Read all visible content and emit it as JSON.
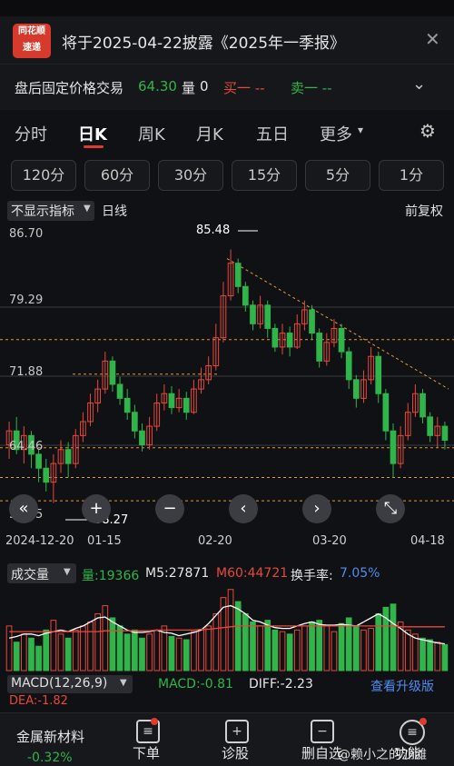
{
  "notice": {
    "logo_top": "同花顺",
    "logo_bottom": "速递",
    "text": "将于2025-04-22披露《2025年一季报》"
  },
  "after_hours": {
    "label": "盘后固定价格交易",
    "price": "64.30",
    "volume_label": "量",
    "volume": "0",
    "sell1": "买一 --",
    "buy1": "卖一 --"
  },
  "tabs": [
    "分时",
    "日K",
    "周K",
    "月K",
    "五日",
    "更多"
  ],
  "minute_buttons": [
    "120分",
    "60分",
    "30分",
    "15分",
    "5分",
    "1分"
  ],
  "indicator_bar": {
    "selector": "不显示指标",
    "period": "日线",
    "adjust": "前复权"
  },
  "chart_data": {
    "type": "candlestick",
    "y_ticks": [
      "86.70",
      "79.29",
      "71.88",
      "64.46",
      "57.05"
    ],
    "ylim": [
      57.05,
      86.7
    ],
    "x_ticks": [
      "2024-12-20",
      "01-15",
      "02-20",
      "03-20",
      "04-18"
    ],
    "high_label": "85.48",
    "low_label": "58.27",
    "colors": {
      "up": "#e8483a",
      "down": "#2fb54a",
      "ma": "#e39a3b"
    },
    "candles": [
      [
        64.5,
        66.0,
        63.0,
        67.0
      ],
      [
        66.0,
        64.0,
        63.5,
        67.5
      ],
      [
        64.0,
        65.5,
        62.5,
        66.5
      ],
      [
        65.5,
        63.5,
        62.0,
        66.0
      ],
      [
        63.5,
        62.0,
        60.5,
        64.0
      ],
      [
        62.0,
        60.5,
        59.5,
        63.0
      ],
      [
        60.5,
        62.5,
        58.27,
        63.5
      ],
      [
        62.5,
        64.0,
        61.5,
        65.0
      ],
      [
        64.0,
        62.5,
        61.0,
        64.8
      ],
      [
        62.5,
        65.5,
        62.0,
        66.2
      ],
      [
        65.5,
        67.0,
        64.8,
        68.0
      ],
      [
        67.0,
        69.0,
        66.5,
        70.0
      ],
      [
        69.0,
        70.5,
        68.0,
        71.5
      ],
      [
        70.5,
        73.5,
        70.0,
        74.5
      ],
      [
        73.5,
        71.0,
        70.2,
        74.0
      ],
      [
        71.0,
        69.5,
        68.8,
        71.8
      ],
      [
        69.5,
        68.0,
        67.2,
        70.5
      ],
      [
        68.0,
        66.0,
        65.2,
        68.8
      ],
      [
        66.0,
        64.5,
        63.8,
        66.8
      ],
      [
        64.5,
        66.5,
        64.0,
        67.5
      ],
      [
        66.5,
        69.0,
        66.0,
        70.0
      ],
      [
        69.0,
        70.0,
        68.2,
        71.0
      ],
      [
        70.0,
        68.5,
        67.8,
        70.8
      ],
      [
        68.5,
        69.5,
        68.0,
        70.5
      ],
      [
        69.5,
        68.0,
        67.2,
        70.2
      ],
      [
        68.0,
        70.5,
        67.8,
        71.5
      ],
      [
        70.5,
        71.5,
        70.0,
        72.8
      ],
      [
        71.5,
        73.0,
        71.0,
        74.0
      ],
      [
        73.0,
        76.0,
        72.5,
        77.5
      ],
      [
        76.0,
        80.5,
        75.5,
        82.0
      ],
      [
        80.5,
        84.0,
        80.0,
        85.48
      ],
      [
        84.0,
        81.5,
        80.8,
        84.5
      ],
      [
        81.5,
        79.5,
        78.8,
        82.0
      ],
      [
        79.5,
        77.5,
        76.8,
        80.0
      ],
      [
        77.5,
        79.5,
        77.0,
        80.5
      ],
      [
        79.5,
        77.0,
        76.0,
        80.0
      ],
      [
        77.0,
        75.0,
        74.5,
        77.5
      ],
      [
        75.0,
        76.5,
        74.2,
        77.5
      ],
      [
        76.5,
        75.0,
        74.0,
        77.2
      ],
      [
        75.0,
        77.5,
        74.8,
        78.5
      ],
      [
        77.5,
        79.0,
        76.8,
        80.0
      ],
      [
        79.0,
        76.5,
        75.8,
        79.5
      ],
      [
        76.5,
        73.5,
        72.8,
        77.0
      ],
      [
        73.5,
        75.5,
        73.0,
        76.5
      ],
      [
        75.5,
        77.0,
        75.0,
        78.0
      ],
      [
        77.0,
        74.5,
        73.8,
        77.5
      ],
      [
        74.5,
        71.5,
        70.5,
        75.0
      ],
      [
        71.5,
        69.5,
        68.5,
        72.0
      ],
      [
        69.5,
        71.5,
        69.0,
        72.5
      ],
      [
        71.5,
        74.0,
        71.0,
        75.0
      ],
      [
        74.0,
        70.0,
        69.0,
        74.5
      ],
      [
        70.0,
        66.0,
        65.0,
        70.5
      ],
      [
        66.0,
        62.5,
        61.0,
        66.8
      ],
      [
        62.5,
        65.5,
        62.0,
        66.5
      ],
      [
        65.5,
        68.0,
        65.0,
        69.0
      ],
      [
        68.0,
        70.0,
        67.5,
        71.0
      ],
      [
        70.0,
        67.5,
        66.8,
        70.5
      ],
      [
        67.5,
        65.5,
        64.8,
        68.0
      ],
      [
        65.5,
        66.5,
        64.2,
        67.5
      ],
      [
        66.5,
        65.0,
        64.0,
        67.0
      ]
    ]
  },
  "chart_controls": [
    "«",
    "+",
    "−",
    "‹",
    "›",
    "⤡"
  ],
  "volume": {
    "selector": "成交量",
    "vol_label": "量:19366",
    "m5_label": "M5:27871",
    "m60_label": "M60:44721",
    "turnover_label": "换手率:",
    "turnover_value": "7.05%",
    "bars": [
      0.55,
      0.35,
      0.45,
      0.4,
      0.3,
      0.5,
      0.62,
      0.45,
      0.4,
      0.5,
      0.55,
      0.6,
      0.7,
      0.8,
      0.65,
      0.55,
      0.45,
      0.5,
      0.4,
      0.45,
      0.5,
      0.55,
      0.42,
      0.4,
      0.38,
      0.48,
      0.5,
      0.55,
      0.7,
      0.9,
      1.0,
      0.85,
      0.7,
      0.6,
      0.55,
      0.62,
      0.5,
      0.48,
      0.45,
      0.5,
      0.55,
      0.6,
      0.62,
      0.55,
      0.48,
      0.58,
      0.65,
      0.55,
      0.5,
      0.52,
      0.7,
      0.78,
      0.82,
      0.6,
      0.5,
      0.45,
      0.4,
      0.38,
      0.35,
      0.32
    ],
    "m5_line": [
      0.4,
      0.42,
      0.45,
      0.45,
      0.43,
      0.46,
      0.48,
      0.5,
      0.48,
      0.52,
      0.55,
      0.6,
      0.65,
      0.66,
      0.6,
      0.55,
      0.5,
      0.47,
      0.47,
      0.48,
      0.5,
      0.47,
      0.46,
      0.43,
      0.45,
      0.47,
      0.5,
      0.58,
      0.68,
      0.78,
      0.8,
      0.76,
      0.7,
      0.62,
      0.6,
      0.56,
      0.53,
      0.52,
      0.52,
      0.55,
      0.58,
      0.6,
      0.57,
      0.56,
      0.56,
      0.57,
      0.56,
      0.55,
      0.6,
      0.65,
      0.7,
      0.65,
      0.58,
      0.52,
      0.45,
      0.4,
      0.38,
      0.36,
      0.34,
      0.33
    ],
    "m60_line": [
      0.48,
      0.48,
      0.48,
      0.48,
      0.48,
      0.48,
      0.48,
      0.48,
      0.48,
      0.48,
      0.48,
      0.48,
      0.48,
      0.49,
      0.49,
      0.49,
      0.49,
      0.49,
      0.49,
      0.49,
      0.5,
      0.5,
      0.5,
      0.5,
      0.5,
      0.5,
      0.51,
      0.51,
      0.52,
      0.53,
      0.54,
      0.55,
      0.55,
      0.55,
      0.55,
      0.55,
      0.55,
      0.55,
      0.55,
      0.55,
      0.55,
      0.55,
      0.55,
      0.55,
      0.55,
      0.55,
      0.55,
      0.55,
      0.55,
      0.55,
      0.55,
      0.55,
      0.55,
      0.54,
      0.54,
      0.54,
      0.54,
      0.54,
      0.54,
      0.54
    ]
  },
  "macd": {
    "selector": "MACD(12,26,9)",
    "macd_label": "MACD:-0.81",
    "diff_label": "DIFF:-2.23",
    "upgrade_label": "查看升级版",
    "dea_label": "DEA:-1.82"
  },
  "bottom_bar": {
    "stock_name": "金属新材料",
    "stock_change": "-0.32%",
    "order": "下单",
    "diagnose": "诊股",
    "delete_watch": "删自选",
    "more": "功能",
    "watermark": "@赖小之的沙滩"
  }
}
